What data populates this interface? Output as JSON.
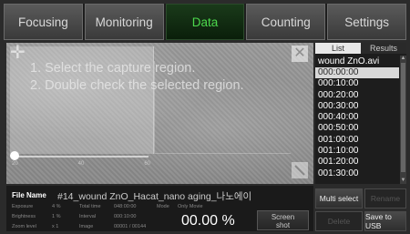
{
  "tabs": [
    {
      "label": "Focusing",
      "active": false
    },
    {
      "label": "Monitoring",
      "active": false
    },
    {
      "label": "Data",
      "active": true
    },
    {
      "label": "Counting",
      "active": false
    },
    {
      "label": "Settings",
      "active": false
    }
  ],
  "capture": {
    "instruction_1": "1. Select the capture region.",
    "instruction_2": "2. Double check the selected region.",
    "icons": {
      "move": "plus-icon",
      "close": "close-icon",
      "resize": "resize-icon"
    },
    "ticks": [
      "20",
      "40",
      "60"
    ],
    "slider_value": 0
  },
  "list_panel": {
    "tab_list": "List",
    "tab_results": "Results",
    "file_title": "wound ZnO.avi",
    "items": [
      "000:00:00",
      "000:10:00",
      "000:20:00",
      "000:30:00",
      "000:40:00",
      "000:50:00",
      "001:00:00",
      "001:10:00",
      "001:20:00",
      "001:30:00"
    ],
    "selected_index": 0
  },
  "info": {
    "file_name_label": "File Name",
    "file_name": "#14_wound ZnO_Hacat_nano aging_나노에이",
    "exposure_label": "Exposure",
    "exposure_value": "4 %",
    "brightness_label": "Brightness",
    "brightness_value": "1 %",
    "zoom_label": "Zoom level",
    "zoom_value": "x 1",
    "total_time_label": "Total time",
    "total_time_value": "048:00:00",
    "interval_label": "Interval",
    "interval_value": "000:10:00",
    "image_label": "Image",
    "image_value": "00001 / 00144",
    "mode_label": "Mode",
    "mode_value": "Only Movie",
    "percent": "00.00 %",
    "screenshot_line1": "Screen",
    "screenshot_line2": "shot"
  },
  "buttons": {
    "multi_select": "Multi select",
    "rename": "Rename",
    "delete": "Delete",
    "save_usb": "Save to USB"
  }
}
